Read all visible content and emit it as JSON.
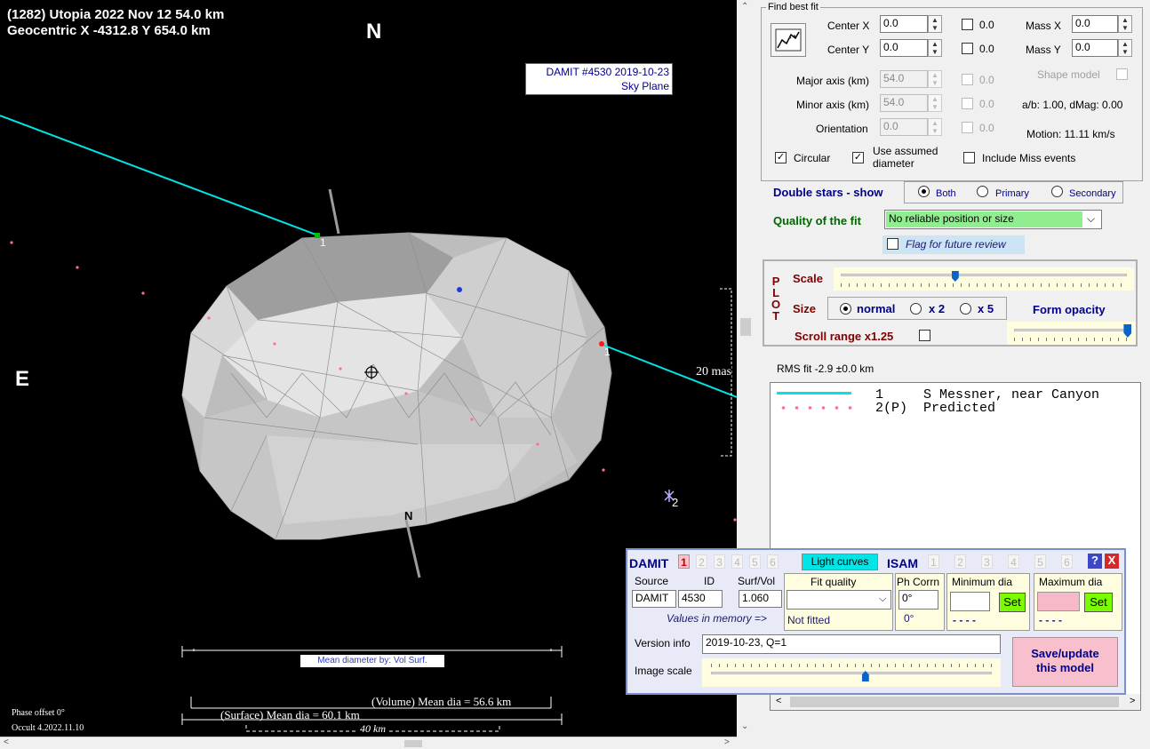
{
  "plot": {
    "title_line1": "(1282) Utopia  2022 Nov 12   54.0 km",
    "title_line2": "Geocentric X  -4312.8  Y 654.0 km",
    "north": "N",
    "east": "E",
    "model_box_line1": "DAMIT #4530 2019-10-23",
    "model_box_line2": "Sky Plane",
    "scale_label": "20 mas",
    "chord_label_1": "1",
    "chord_label_1b": "1",
    "star_label": "2",
    "pole_label": "N",
    "mean_diameter_by": "Mean diameter by:  Vol  Surf.",
    "volume_dia": "(Volume) Mean dia = 56.6 km",
    "surface_dia": "(Surface) Mean dia = 60.1 km",
    "km_scale": "40 km",
    "phase_offset": "Phase offset 0°",
    "occult_version": "Occult 4.2022.11.10"
  },
  "fit": {
    "group_title": "Find best fit",
    "center_x_label": "Center X",
    "center_x": "0.0",
    "center_x_sd": "0.0",
    "center_y_label": "Center Y",
    "center_y": "0.0",
    "center_y_sd": "0.0",
    "mass_x_label": "Mass X",
    "mass_x": "0.0",
    "mass_y_label": "Mass Y",
    "mass_y": "0.0",
    "shape_model_label": "Shape model",
    "major_label": "Major axis (km)",
    "major": "54.0",
    "major_sd": "0.0",
    "minor_label": "Minor axis (km)",
    "minor": "54.0",
    "minor_sd": "0.0",
    "orientation_label": "Orientation",
    "orientation": "0.0",
    "orientation_sd": "0.0",
    "ab_text": "a/b: 1.00, dMag: 0.00",
    "motion_text": "Motion: 11.11 km/s",
    "circular_label": "Circular",
    "use_assumed_label_1": "Use assumed",
    "use_assumed_label_2": "diameter",
    "include_miss_label": "Include Miss events"
  },
  "double_stars": {
    "label": "Double stars - show",
    "options": [
      "Both",
      "Primary",
      "Secondary"
    ],
    "selected": "Both"
  },
  "quality": {
    "label": "Quality of the fit",
    "value": "No reliable position or size",
    "flag_label": "Flag for future review"
  },
  "plot_opts": {
    "side_label": [
      "P",
      "L",
      "O",
      "T"
    ],
    "scale_label": "Scale",
    "scale_value": 0.4,
    "size_label": "Size",
    "size_options": [
      "normal",
      "x 2",
      "x 5"
    ],
    "size_selected": "normal",
    "form_opacity_label": "Form opacity",
    "form_opacity_value": 0.98,
    "scroll_range_label": "Scroll range x1.25"
  },
  "rms": "RMS fit -2.9 ±0.0 km",
  "legend": [
    {
      "style": "line",
      "color": "#00e5e5",
      "text": "1     S Messner, near Canyon"
    },
    {
      "style": "dots",
      "color": "#ff69b4",
      "text": "2(P)  Predicted"
    }
  ],
  "damit": {
    "title": "DAMIT",
    "nums": [
      "1",
      "2",
      "3",
      "4",
      "5",
      "6"
    ],
    "light_curves": "Light curves",
    "isam": "ISAM",
    "isam_nums": [
      "1",
      "2",
      "3",
      "4",
      "5",
      "6"
    ],
    "help": "?",
    "close": "X",
    "source_header": "Source",
    "id_header": "ID",
    "surfvol_header": "Surf/Vol",
    "source": "DAMIT",
    "id": "4530",
    "surfvol": "1.060",
    "values_in_memory": "Values in memory =>",
    "fit_quality_header": "Fit quality",
    "fit_quality_value": "",
    "not_fitted": "Not fitted",
    "ph_corrn_header": "Ph Corrn",
    "ph_corrn": "0°",
    "ph_corrn_mem": "0°",
    "min_dia_header": "Minimum dia",
    "max_dia_header": "Maximum dia",
    "set_label": "Set",
    "dashes": "- - - -",
    "version_label": "Version info",
    "version_value": "2019-10-23, Q=1",
    "image_scale_label": "Image scale",
    "image_scale_value": 0.55,
    "save_label_1": "Save/update",
    "save_label_2": "this model"
  }
}
